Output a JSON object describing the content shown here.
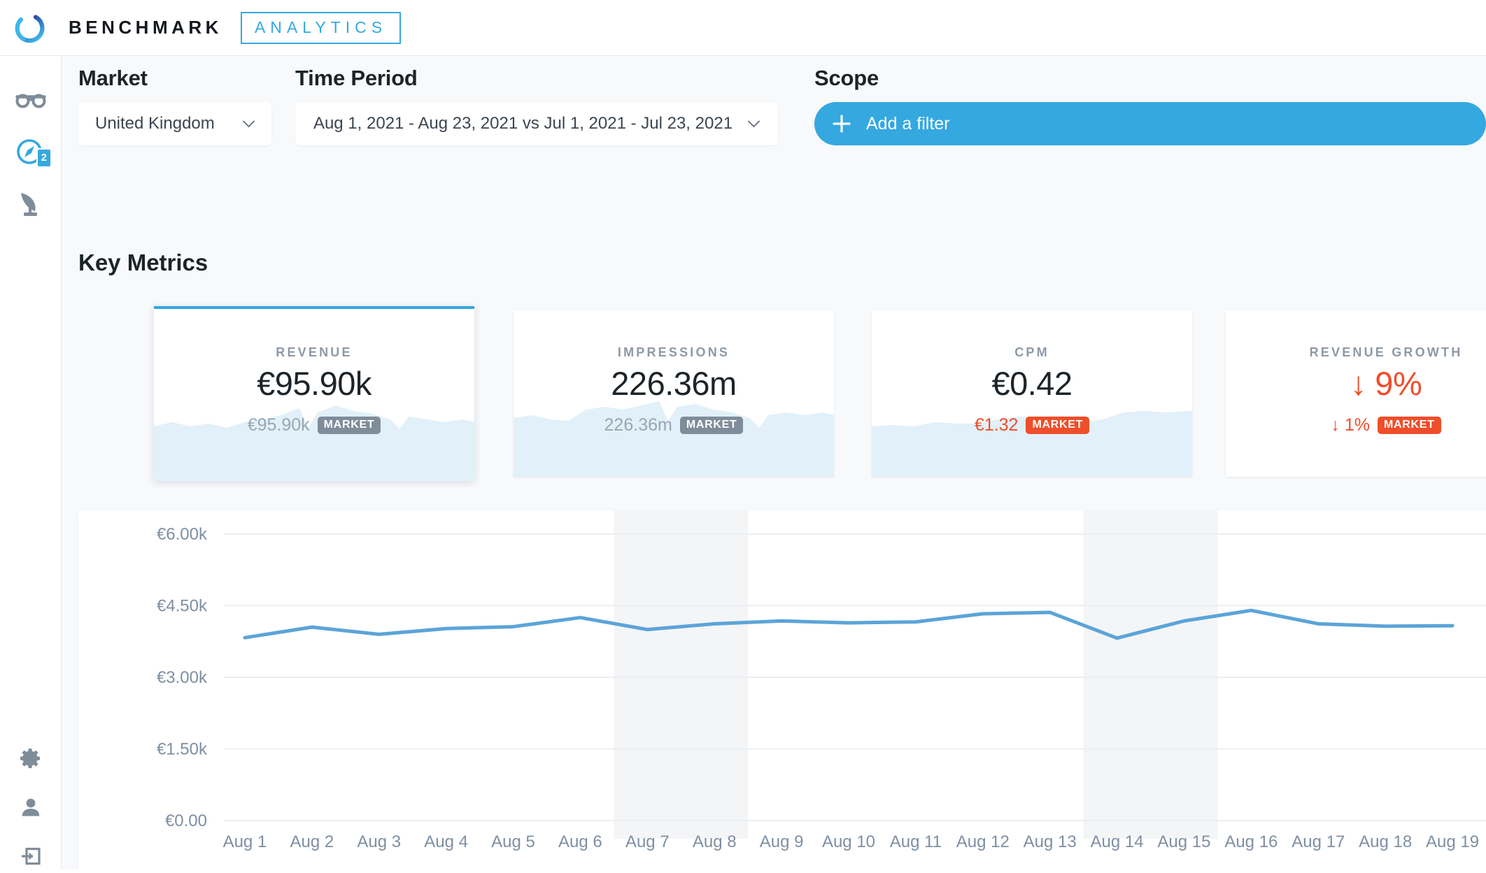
{
  "header": {
    "logo_icon": "ring-logo-icon",
    "brand": "BENCHMARK",
    "brand_secondary": "ANALYTICS"
  },
  "sidebar": {
    "items": [
      {
        "name": "glasses-icon",
        "label": "Insights",
        "active": false
      },
      {
        "name": "compass-icon",
        "label": "Explore",
        "active": true,
        "badge": "2"
      },
      {
        "name": "quill-icon",
        "label": "Reports",
        "active": false
      }
    ],
    "bottom_items": [
      {
        "name": "gear-icon",
        "label": "Settings"
      },
      {
        "name": "person-icon",
        "label": "Account"
      },
      {
        "name": "logout-icon",
        "label": "Sign out"
      }
    ]
  },
  "filters": {
    "market": {
      "label": "Market",
      "value": "United Kingdom"
    },
    "time_period": {
      "label": "Time Period",
      "value": "Aug 1, 2021 - Aug 23, 2021  vs Jul 1, 2021 - Jul 23, 2021"
    },
    "scope": {
      "label": "Scope",
      "add_filter_label": "Add a filter"
    }
  },
  "key_metrics": {
    "title": "Key Metrics",
    "cards": [
      {
        "kicker": "REVENUE",
        "value": "€95.90k",
        "sub_value": "€95.90k",
        "badge": "MARKET",
        "badge_alert": false,
        "value_alert": false,
        "selected": true,
        "has_sparkline": true
      },
      {
        "kicker": "IMPRESSIONS",
        "value": "226.36m",
        "sub_value": "226.36m",
        "badge": "MARKET",
        "badge_alert": false,
        "value_alert": false,
        "selected": false,
        "has_sparkline": true
      },
      {
        "kicker": "CPM",
        "value": "€0.42",
        "sub_value": "€1.32",
        "badge": "MARKET",
        "badge_alert": true,
        "value_alert": false,
        "selected": false,
        "has_sparkline": true
      },
      {
        "kicker": "REVENUE GROWTH",
        "value": "↓ 9%",
        "sub_value": "↓ 1%",
        "badge": "MARKET",
        "badge_alert": true,
        "value_alert": true,
        "selected": false,
        "has_sparkline": false
      }
    ]
  },
  "colors": {
    "accent": "#35a8e0",
    "alert": "#ef4e2a",
    "line": "#5ba4d8",
    "canvas": "#f7f9fb",
    "muted_badge": "#7f8c99"
  },
  "chart_data": {
    "type": "line",
    "title": "",
    "xlabel": "",
    "ylabel": "",
    "ylim": [
      0,
      6000
    ],
    "yticks": [
      0,
      1500,
      3000,
      4500,
      6000
    ],
    "ytick_labels": [
      "€0.00",
      "€1.50k",
      "€3.00k",
      "€4.50k",
      "€6.00k"
    ],
    "grid": true,
    "legend": false,
    "categories": [
      "Aug 1",
      "Aug 2",
      "Aug 3",
      "Aug 4",
      "Aug 5",
      "Aug 6",
      "Aug 7",
      "Aug 8",
      "Aug 9",
      "Aug 10",
      "Aug 11",
      "Aug 12",
      "Aug 13",
      "Aug 14",
      "Aug 15",
      "Aug 16",
      "Aug 17",
      "Aug 18",
      "Aug 19"
    ],
    "series": [
      {
        "name": "Revenue",
        "color": "#5ba4d8",
        "values": [
          3830,
          4050,
          3900,
          4020,
          4060,
          4250,
          4000,
          4120,
          4180,
          4140,
          4160,
          4330,
          4360,
          3820,
          4180,
          4400,
          4120,
          4070,
          4080
        ]
      }
    ],
    "shaded_bands": [
      {
        "from": "Aug 7",
        "to": "Aug 8",
        "color": "#f4f5f7"
      },
      {
        "from": "Aug 14",
        "to": "Aug 15",
        "color": "#f4f5f7"
      }
    ]
  }
}
